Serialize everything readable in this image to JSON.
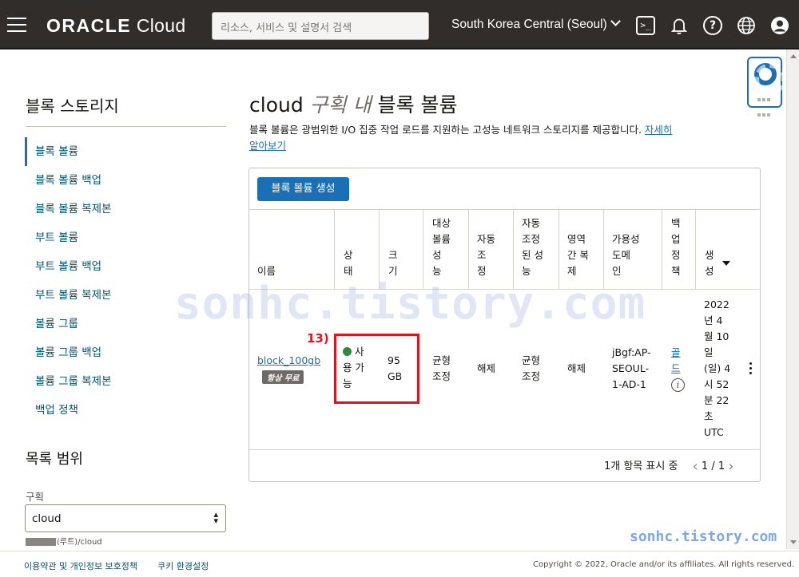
{
  "topbar": {
    "logo_bold": "ORACLE",
    "logo_light": "Cloud",
    "search_placeholder": "리소스, 서비스 및 설명서 검색",
    "region": "South Korea Central (Seoul)"
  },
  "sidebar": {
    "title": "블록 스토리지",
    "items": [
      {
        "label": "블록 볼륨"
      },
      {
        "label": "블록 볼륨 백업"
      },
      {
        "label": "블록 볼륨 복제본"
      },
      {
        "label": "부트 볼륨"
      },
      {
        "label": "부트 볼륨 백업"
      },
      {
        "label": "부트 볼륨 복제본"
      },
      {
        "label": "볼륨 그룹"
      },
      {
        "label": "볼륨 그룹 백업"
      },
      {
        "label": "볼륨 그룹 복제본"
      },
      {
        "label": "백업 정책"
      }
    ],
    "scope_title": "목록 범위",
    "compartment_label": "구획",
    "compartment_value": "cloud",
    "compartment_path": "(루트)/cloud"
  },
  "main": {
    "title_compartment": "cloud",
    "title_mid": "구획 내",
    "title_end": "블록 볼륨",
    "description": "블록 볼륨은 광범위한 I/O 집중 작업 로드를 지원하는 고성능 네트워크 스토리지를 제공합니다.",
    "learn_more_1": "자세히",
    "learn_more_2": "알아보기",
    "create_button": "블록 볼륨 생성",
    "columns": {
      "name": "이름",
      "state": [
        "상",
        "태"
      ],
      "size": [
        "크",
        "기"
      ],
      "target_perf": [
        "대상",
        "볼륨",
        "성",
        "능"
      ],
      "auto_tune": [
        "자동",
        "조",
        "정"
      ],
      "auto_tuned_perf": [
        "자동",
        "조정",
        "된 성",
        "능"
      ],
      "cross_region": [
        "영역",
        "간 복",
        "제"
      ],
      "ad": [
        "가용성",
        "도메",
        "인"
      ],
      "backup_policy": [
        "백",
        "업",
        "정",
        "책"
      ],
      "created": [
        "생",
        "성"
      ]
    },
    "row": {
      "name": "block_100gb",
      "badge": "항상 무료",
      "state": [
        "사",
        "용 가",
        "능"
      ],
      "size": [
        "95",
        "GB"
      ],
      "target_perf": [
        "균형",
        "조정"
      ],
      "auto_tune": "해제",
      "auto_tuned_perf": [
        "균형",
        "조정"
      ],
      "cross_region": "해제",
      "ad": [
        "jBgf:AP-",
        "SEOUL-",
        "1-AD-1"
      ],
      "backup_policy": [
        "골",
        "드"
      ],
      "created": [
        "2022",
        "년 4",
        "월 10",
        "일",
        "(일) 4",
        "시 52",
        "분 22",
        "초",
        "UTC"
      ]
    },
    "pager_text": "1개 항목 표시 중",
    "pager_pages": "1 / 1",
    "annotation": "13)"
  },
  "watermark": "sonhc.tistory.com",
  "watermark_small": "sonhc.tistory.com",
  "footer": {
    "terms": "이용약관 및 개인정보 보호정책",
    "cookies": "쿠키 환경설정",
    "copyright": "Copyright © 2022, Oracle and/or its affiliates. All rights reserved."
  },
  "colors": {
    "topbar": "#312d2a",
    "accent": "#1b6fb4",
    "status_ok": "#2e8b3d",
    "annotation": "#e0141e"
  }
}
